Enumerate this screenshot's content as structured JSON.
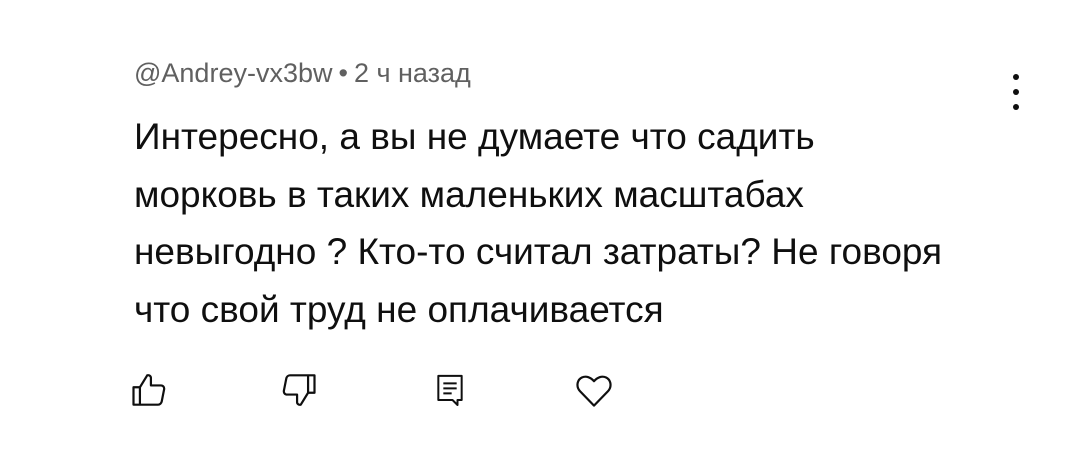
{
  "comment": {
    "author": "@Andrey-vx3bw",
    "separator": "•",
    "time": "2 ч назад",
    "text": "Интересно, а вы не думаете что садить\nморковь в таких маленьких масштабах\nневыгодно ? Кто-то считал затраты? Не говоря\nчто свой труд не оплачивается"
  },
  "actions": {
    "like_icon": "thumb-up-icon",
    "dislike_icon": "thumb-down-icon",
    "reply_icon": "reply-icon",
    "heart_icon": "heart-icon"
  },
  "more_icon": "more-vertical-icon",
  "colors": {
    "text": "#0f0f0f",
    "meta": "#606060",
    "background": "#ffffff"
  }
}
